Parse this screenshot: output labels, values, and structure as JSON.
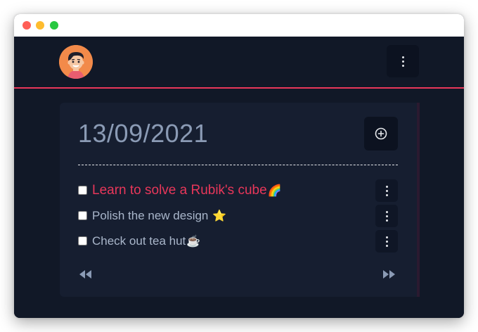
{
  "window": {
    "traffic_lights": [
      "close",
      "minimize",
      "maximize"
    ]
  },
  "header": {
    "avatar_icon": "cartoon-avatar-icon",
    "menu_icon": "vertical-dots-icon"
  },
  "card": {
    "date": "13/09/2021",
    "add_icon": "plus-circle-icon",
    "tasks": [
      {
        "label": "Learn to solve a Rubik's cube",
        "emoji": "🌈",
        "checked": false,
        "highlighted": true
      },
      {
        "label": "Polish the new design",
        "emoji": "⭐",
        "checked": false,
        "highlighted": false
      },
      {
        "label": "Check out tea hut",
        "emoji": "☕",
        "checked": false,
        "highlighted": false
      }
    ],
    "pagination": {
      "prev_icon": "rewind-icon",
      "next_icon": "fast-forward-icon"
    }
  },
  "colors": {
    "background": "#111827",
    "card": "#161e30",
    "accent": "#e8375a",
    "text_muted": "#a9b6ca",
    "date_text": "#8b9bb5"
  }
}
